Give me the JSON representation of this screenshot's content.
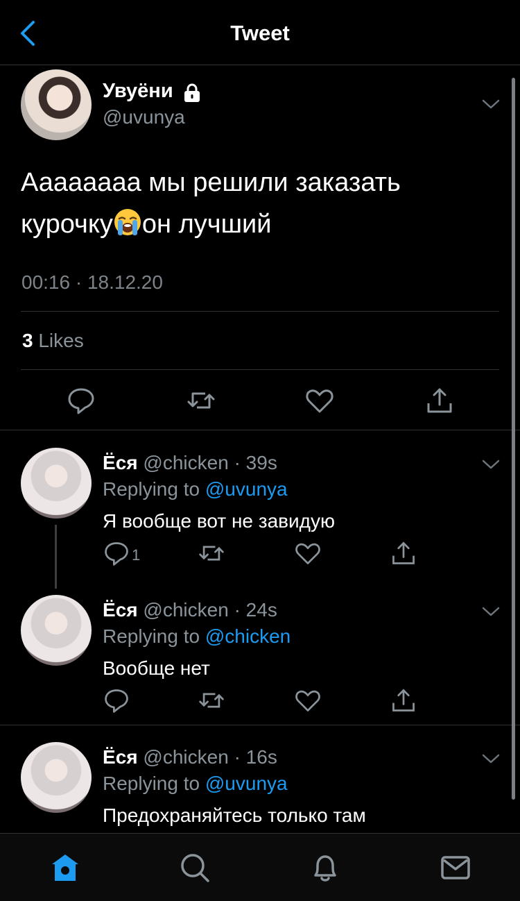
{
  "header": {
    "title": "Tweet",
    "back_icon": "back-chevron-icon"
  },
  "main_tweet": {
    "display_name": "Увуёни",
    "handle": "@uvunya",
    "text_line1": "Аааааааа мы решили заказать",
    "text_line2_before": "курочку",
    "text_line2_after": "он лучший",
    "emoji": "loudly-crying-face",
    "timestamp": "00:16 · 18.12.20",
    "likes_count": "3",
    "likes_label": "Likes",
    "actions": [
      "reply-icon",
      "retweet-icon",
      "like-icon",
      "share-icon"
    ]
  },
  "replies": [
    {
      "name": "Ёся",
      "handle": "@chicken",
      "time": "· 39s",
      "replying_prefix": "Replying to ",
      "replying_to": "@uvunya",
      "text": "Я вообще вот не завидую",
      "reply_count": "1"
    },
    {
      "name": "Ёся",
      "handle": "@chicken",
      "time": "· 24s",
      "replying_prefix": "Replying to ",
      "replying_to": "@chicken",
      "text": "Вообще нет",
      "reply_count": ""
    },
    {
      "name": "Ёся",
      "handle": "@chicken",
      "time": "· 16s",
      "replying_prefix": "Replying to ",
      "replying_to": "@uvunya",
      "text": "Предохраняйтесь только там",
      "reply_count": ""
    }
  ],
  "colors": {
    "accent": "#1d9bf0",
    "background": "#000000",
    "muted": "#8b949a"
  },
  "tabbar": [
    "home-icon",
    "search-icon",
    "notifications-icon",
    "messages-icon"
  ]
}
